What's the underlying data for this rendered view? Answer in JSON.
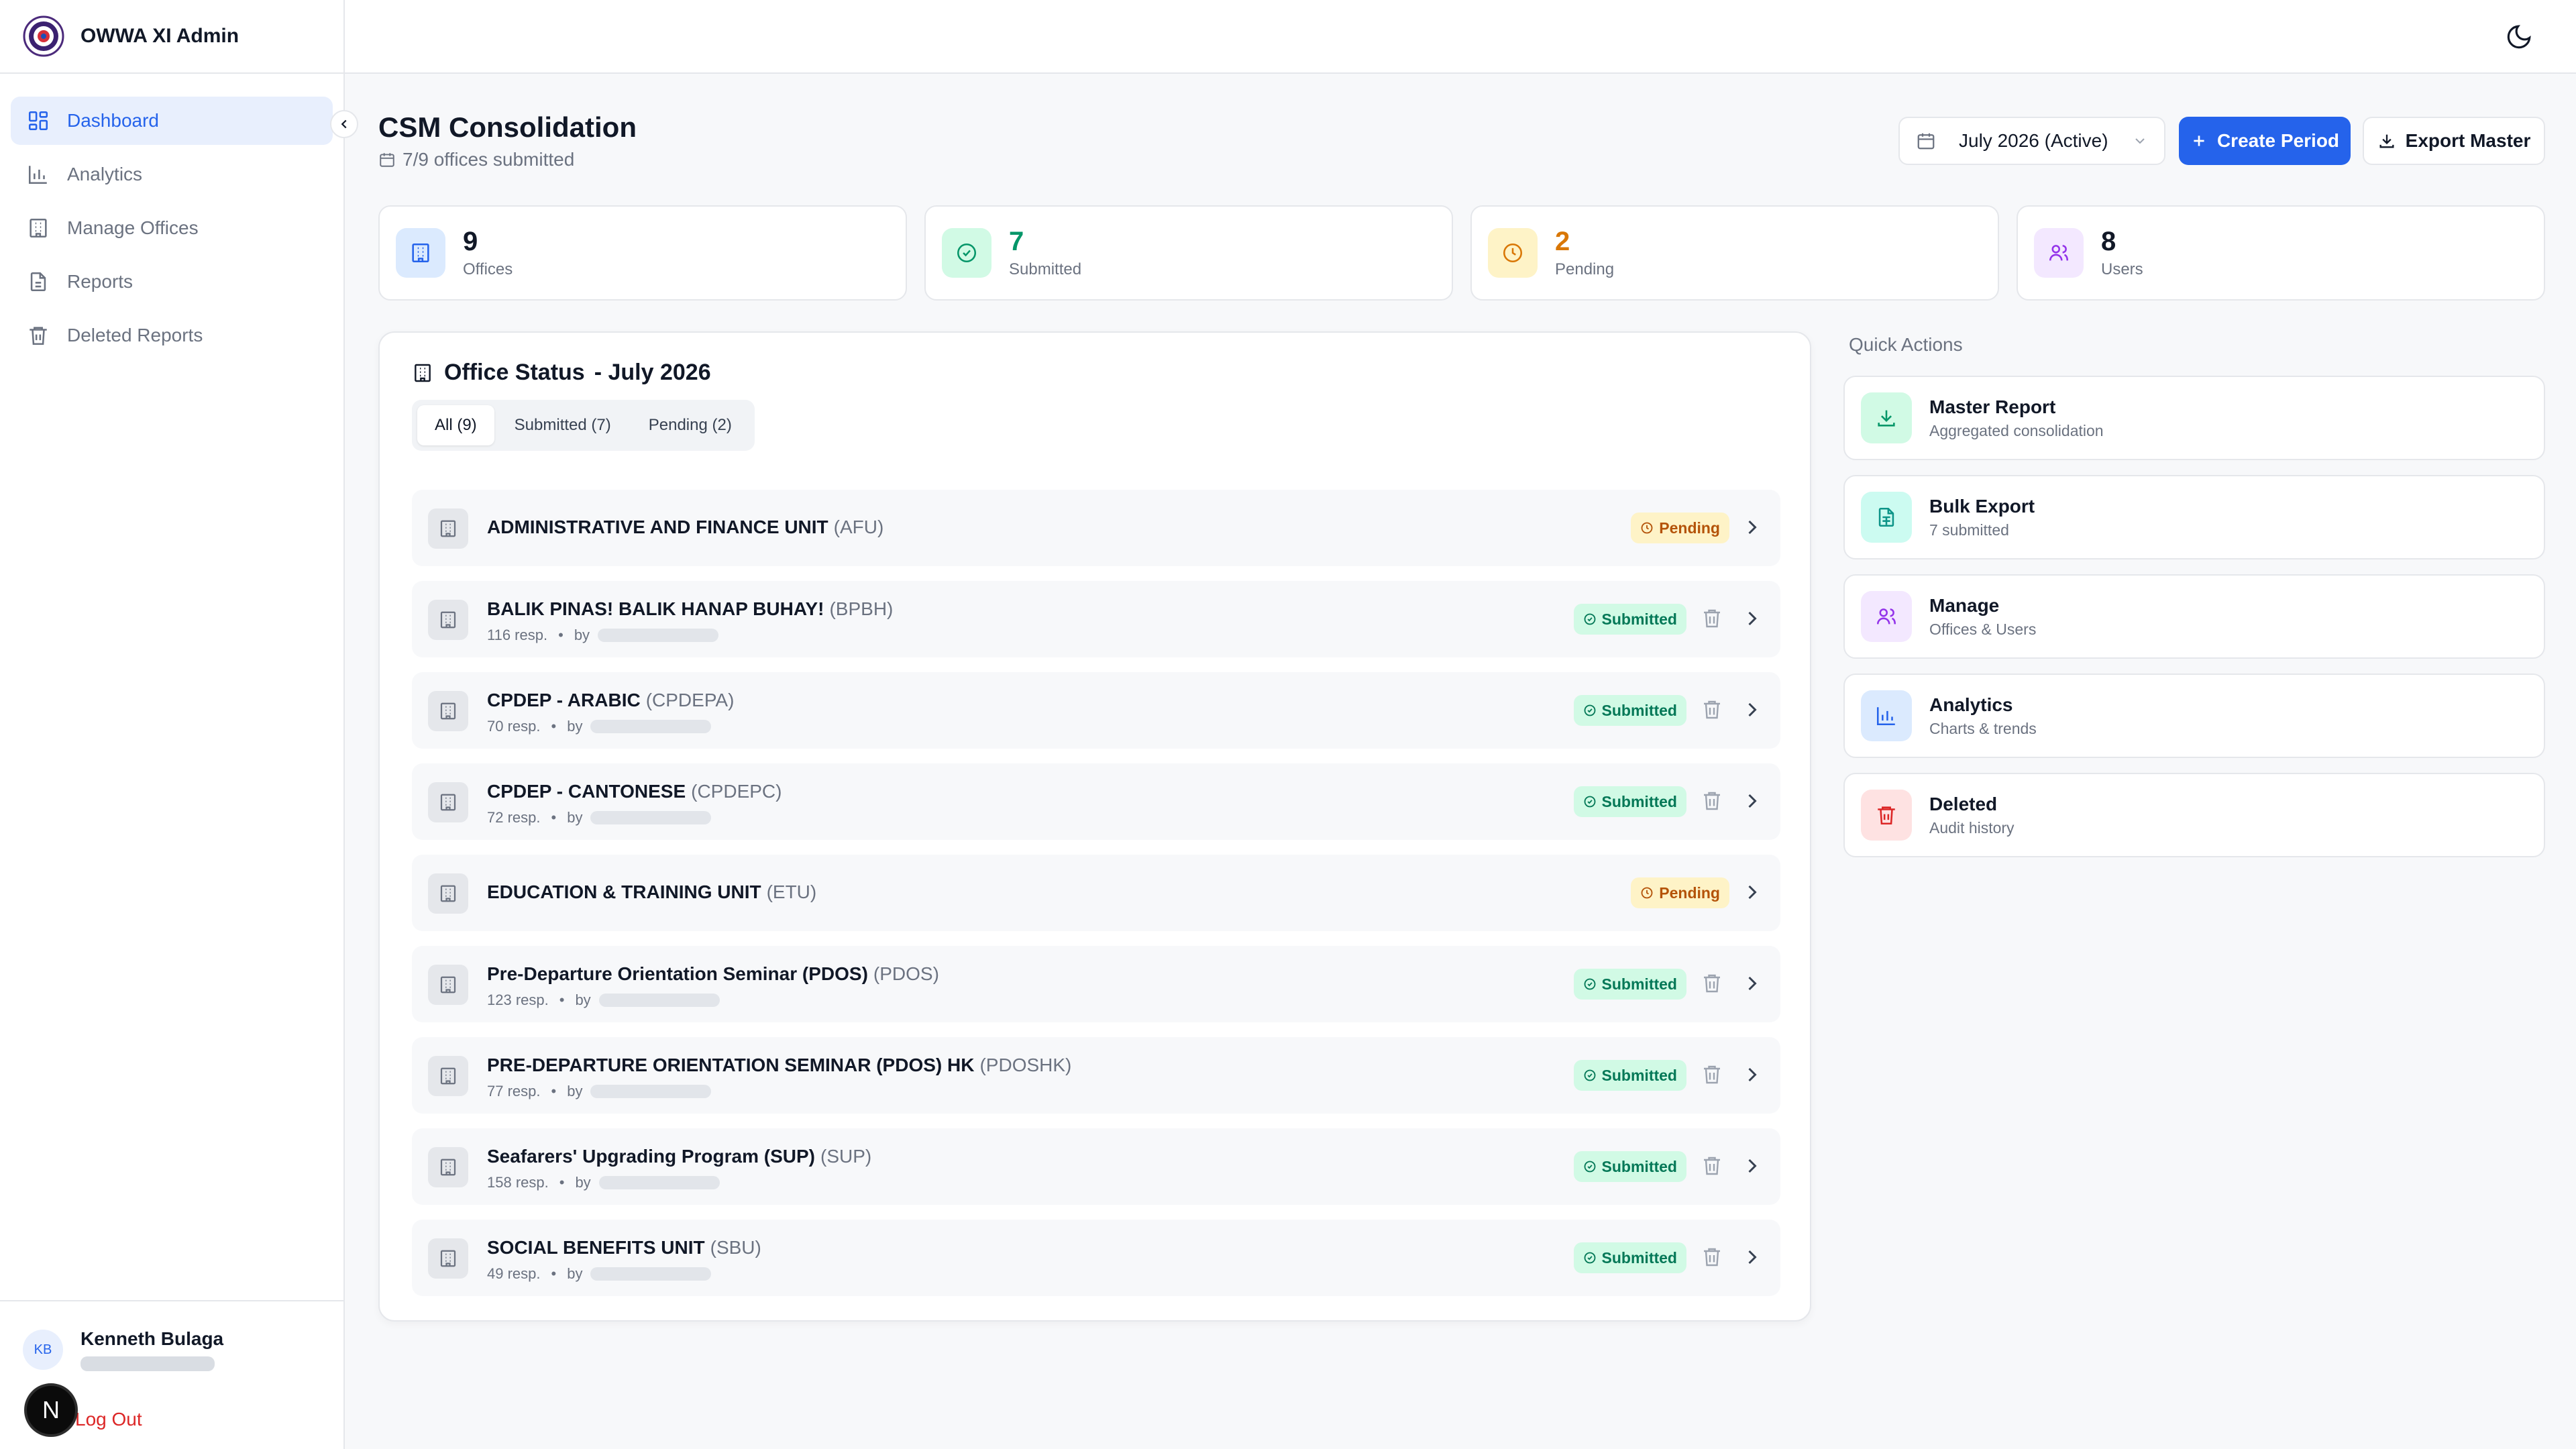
{
  "app": {
    "title": "OWWA XI Admin"
  },
  "sidebar": {
    "items": [
      {
        "label": "Dashboard",
        "icon": "dashboard-icon",
        "active": true
      },
      {
        "label": "Analytics",
        "icon": "bar-chart-icon"
      },
      {
        "label": "Manage Offices",
        "icon": "building-icon"
      },
      {
        "label": "Reports",
        "icon": "file-icon"
      },
      {
        "label": "Deleted Reports",
        "icon": "trash-icon"
      }
    ],
    "user": {
      "initials": "KB",
      "name": "Kenneth Bulaga"
    },
    "logout_label": "Log Out",
    "fab_label": "N"
  },
  "header": {
    "title": "CSM Consolidation",
    "subtitle": "7/9 offices submitted",
    "period_select": "July 2026 (Active)",
    "create_label": "Create Period",
    "export_label": "Export Master"
  },
  "stats": [
    {
      "value": "9",
      "label": "Offices",
      "color": "#2563eb",
      "bg": "#dbeafe"
    },
    {
      "value": "7",
      "label": "Submitted",
      "color": "#059669",
      "bg": "#d1fae5"
    },
    {
      "value": "2",
      "label": "Pending",
      "color": "#d97706",
      "bg": "#fef3c7"
    },
    {
      "value": "8",
      "label": "Users",
      "color": "#111827",
      "bg": "#f3e8ff"
    }
  ],
  "office_status": {
    "title": "Office Status",
    "period": " - July 2026",
    "tabs": [
      {
        "label": "All (9)",
        "active": true
      },
      {
        "label": "Submitted (7)"
      },
      {
        "label": "Pending (2)"
      }
    ],
    "offices": [
      {
        "name": "ADMINISTRATIVE AND FINANCE UNIT",
        "code": "(AFU)",
        "status": "Pending",
        "resp": "",
        "by": ""
      },
      {
        "name": "BALIK PINAS! BALIK HANAP BUHAY!",
        "code": "(BPBH)",
        "status": "Submitted",
        "resp": "116 resp.",
        "by": "by"
      },
      {
        "name": "CPDEP - ARABIC",
        "code": "(CPDEPA)",
        "status": "Submitted",
        "resp": "70 resp.",
        "by": "by"
      },
      {
        "name": "CPDEP - CANTONESE",
        "code": "(CPDEPC)",
        "status": "Submitted",
        "resp": "72 resp.",
        "by": "by"
      },
      {
        "name": "EDUCATION & TRAINING UNIT",
        "code": "(ETU)",
        "status": "Pending",
        "resp": "",
        "by": ""
      },
      {
        "name": "Pre-Departure Orientation Seminar (PDOS)",
        "code": "(PDOS)",
        "status": "Submitted",
        "resp": "123 resp.",
        "by": "by"
      },
      {
        "name": "PRE-DEPARTURE ORIENTATION SEMINAR (PDOS) HK",
        "code": "(PDOSHK)",
        "status": "Submitted",
        "resp": "77 resp.",
        "by": "by"
      },
      {
        "name": "Seafarers' Upgrading Program (SUP)",
        "code": "(SUP)",
        "status": "Submitted",
        "resp": "158 resp.",
        "by": "by"
      },
      {
        "name": "SOCIAL BENEFITS UNIT",
        "code": "(SBU)",
        "status": "Submitted",
        "resp": "49 resp.",
        "by": "by"
      }
    ],
    "dot": "•"
  },
  "quick_actions": {
    "title": "Quick Actions",
    "items": [
      {
        "name": "Master Report",
        "sub": "Aggregated consolidation",
        "color": "#059669",
        "bg": "#d1fae5",
        "icon": "download-icon"
      },
      {
        "name": "Bulk Export",
        "sub": "7 submitted",
        "color": "#0d9488",
        "bg": "#ccfbf1",
        "icon": "file-spreadsheet-icon"
      },
      {
        "name": "Manage",
        "sub": "Offices & Users",
        "color": "#9333ea",
        "bg": "#f3e8ff",
        "icon": "users-icon"
      },
      {
        "name": "Analytics",
        "sub": "Charts & trends",
        "color": "#2563eb",
        "bg": "#dbeafe",
        "icon": "bar-chart-icon"
      },
      {
        "name": "Deleted",
        "sub": "Audit history",
        "color": "#dc2626",
        "bg": "#fee2e2",
        "icon": "trash-icon"
      }
    ]
  }
}
